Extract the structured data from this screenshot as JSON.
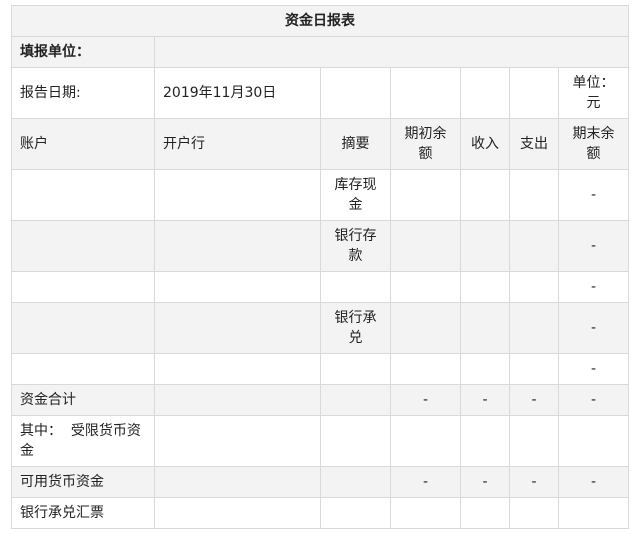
{
  "title": "资金日报表",
  "unit_label": "填报单位：",
  "unit_value": "",
  "date_label": "报告日期:",
  "date_value": "2019年11月30日",
  "currency_note": "单位：元",
  "headers": [
    "账户",
    "开户行",
    "摘要",
    "期初余额",
    "收入",
    "支出",
    "期末余额"
  ],
  "rows": [
    [
      "",
      "",
      "库存现金",
      "",
      "",
      "",
      "-"
    ],
    [
      "",
      "",
      "银行存款",
      "",
      "",
      "",
      "-"
    ],
    [
      "",
      "",
      "",
      "",
      "",
      "",
      "-"
    ],
    [
      "",
      "",
      "银行承兑",
      "",
      "",
      "",
      "-"
    ],
    [
      "",
      "",
      "",
      "",
      "",
      "",
      "-"
    ],
    [
      "资金合计",
      "",
      "",
      "-",
      "-",
      "-",
      "-"
    ],
    [
      "其中：  受限货币资金",
      "",
      "",
      "",
      "",
      "",
      ""
    ],
    [
      "可用货币资金",
      "",
      "",
      "-",
      "-",
      "-",
      "-"
    ],
    [
      "银行承兑汇票",
      "",
      "",
      "",
      "",
      "",
      ""
    ]
  ]
}
